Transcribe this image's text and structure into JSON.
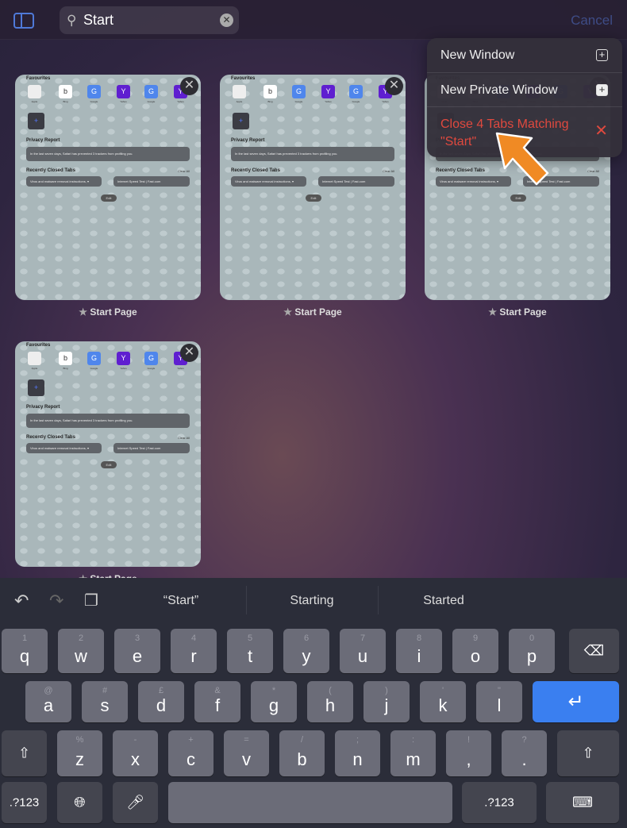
{
  "toolbar": {
    "search_value": "Start",
    "cancel_label": "Cancel"
  },
  "tabs": [
    {
      "title": "Start Page"
    },
    {
      "title": "Start Page"
    },
    {
      "title": "Start Page"
    },
    {
      "title": "Start Page"
    }
  ],
  "tab_preview": {
    "favourites_heading": "Favourites",
    "favourites": [
      {
        "label": "Apple",
        "letter": "",
        "color": "#eeeeee"
      },
      {
        "label": "Bing",
        "letter": "b",
        "color": "#ffffff"
      },
      {
        "label": "Google",
        "letter": "G",
        "color": "#4f86ec"
      },
      {
        "label": "Yahoo",
        "letter": "Y",
        "color": "#5f1fd0"
      },
      {
        "label": "Google",
        "letter": "G",
        "color": "#4f86ec"
      },
      {
        "label": "Yahoo",
        "letter": "Y",
        "color": "#5f1fd0"
      }
    ],
    "privacy_heading": "Privacy Report",
    "privacy_text": "In the last seven days, Safari has prevented 3 trackers from profiling you.",
    "recent_heading": "Recently Closed Tabs",
    "clear_all": "Clear All",
    "recent": [
      "Virus and malware removal instructions, ▾",
      "Internet Speed Test | Fast.com"
    ],
    "edit": "Edit"
  },
  "menu": {
    "items": [
      {
        "label": "New Window",
        "icon": "plus-square-icon"
      },
      {
        "label": "New Private Window",
        "icon": "plus-square-filled-icon"
      },
      {
        "label": "Close 4 Tabs Matching \"Start\"",
        "icon": "close-x-icon",
        "color": "#e0493e"
      }
    ]
  },
  "suggestions": [
    "“Start”",
    "Starting",
    "Started"
  ],
  "keyboard": {
    "rows": [
      [
        [
          "q",
          "1"
        ],
        [
          "w",
          "2"
        ],
        [
          "e",
          "3"
        ],
        [
          "r",
          "4"
        ],
        [
          "t",
          "5"
        ],
        [
          "y",
          "6"
        ],
        [
          "u",
          "7"
        ],
        [
          "i",
          "8"
        ],
        [
          "o",
          "9"
        ],
        [
          "p",
          "0"
        ]
      ],
      [
        [
          "a",
          "@"
        ],
        [
          "s",
          "#"
        ],
        [
          "d",
          "£"
        ],
        [
          "f",
          "&"
        ],
        [
          "g",
          "*"
        ],
        [
          "h",
          "("
        ],
        [
          "j",
          ")"
        ],
        [
          "k",
          "'"
        ],
        [
          "l",
          "\""
        ]
      ],
      [
        [
          "z",
          "%"
        ],
        [
          "x",
          "-"
        ],
        [
          "c",
          "+"
        ],
        [
          "v",
          "="
        ],
        [
          "b",
          "/"
        ],
        [
          "n",
          ";"
        ],
        [
          "m",
          ":"
        ],
        [
          ",",
          "!"
        ],
        [
          ".",
          "?"
        ]
      ]
    ],
    "numbers_label": ".?123",
    "return_color": "#3a7ff0"
  },
  "colors": {
    "accent": "#4f79d8",
    "destructive": "#e0493e",
    "annotation_arrow": "#f08a24"
  }
}
